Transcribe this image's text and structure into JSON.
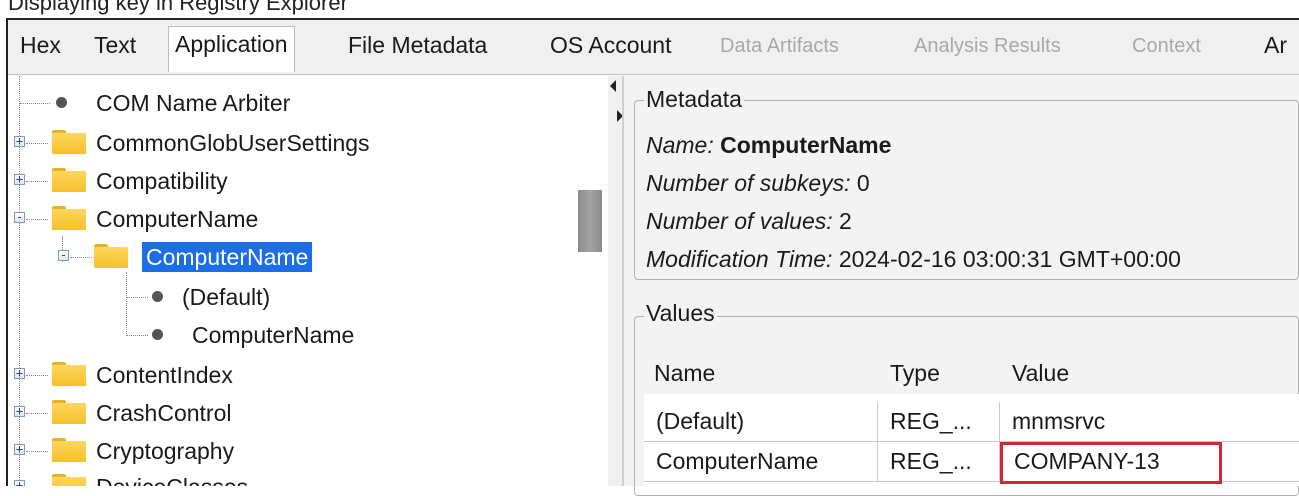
{
  "top_text": "Displaying key in Registry Explorer",
  "tabs": [
    {
      "label": "Hex",
      "state": "enabled"
    },
    {
      "label": "Text",
      "state": "enabled"
    },
    {
      "label": "Application",
      "state": "active"
    },
    {
      "label": "File Metadata",
      "state": "enabled"
    },
    {
      "label": "OS Account",
      "state": "enabled"
    },
    {
      "label": "Data Artifacts",
      "state": "disabled"
    },
    {
      "label": "Analysis Results",
      "state": "disabled"
    },
    {
      "label": "Context",
      "state": "disabled"
    },
    {
      "label": "Ar",
      "state": "enabled"
    }
  ],
  "tree": {
    "items": [
      {
        "label": "COM Name Arbiter",
        "kind": "value"
      },
      {
        "label": "CommonGlobUserSettings",
        "kind": "folder",
        "expander": "+"
      },
      {
        "label": "Compatibility",
        "kind": "folder",
        "expander": "+"
      },
      {
        "label": "ComputerName",
        "kind": "folder",
        "expander": "-"
      },
      {
        "label": "ComputerName",
        "kind": "folder",
        "expander": "-",
        "selected": true
      },
      {
        "label": "(Default)",
        "kind": "value"
      },
      {
        "label": "ComputerName",
        "kind": "value"
      },
      {
        "label": "ContentIndex",
        "kind": "folder",
        "expander": "+"
      },
      {
        "label": "CrashControl",
        "kind": "folder",
        "expander": "+"
      },
      {
        "label": "Cryptography",
        "kind": "folder",
        "expander": "+"
      },
      {
        "label": "DeviceClasses",
        "kind": "folder",
        "expander": "+"
      }
    ]
  },
  "metadata": {
    "group_title": "Metadata",
    "name_label": "Name:",
    "name_value": "ComputerName",
    "subkeys_label": "Number of subkeys:",
    "subkeys_value": "0",
    "values_label": "Number of values:",
    "values_value": "2",
    "mod_label": "Modification Time:",
    "mod_value": "2024-02-16 03:00:31 GMT+00:00"
  },
  "values": {
    "group_title": "Values",
    "headers": [
      "Name",
      "Type",
      "Value"
    ],
    "rows": [
      [
        "(Default)",
        "REG_...",
        "mnmsrvc"
      ],
      [
        "ComputerName",
        "REG_...",
        "COMPANY-13"
      ]
    ]
  },
  "colors": {
    "selection": "#1b6ee8",
    "highlight_border": "#d4263b",
    "folder": "#f5c02a"
  }
}
